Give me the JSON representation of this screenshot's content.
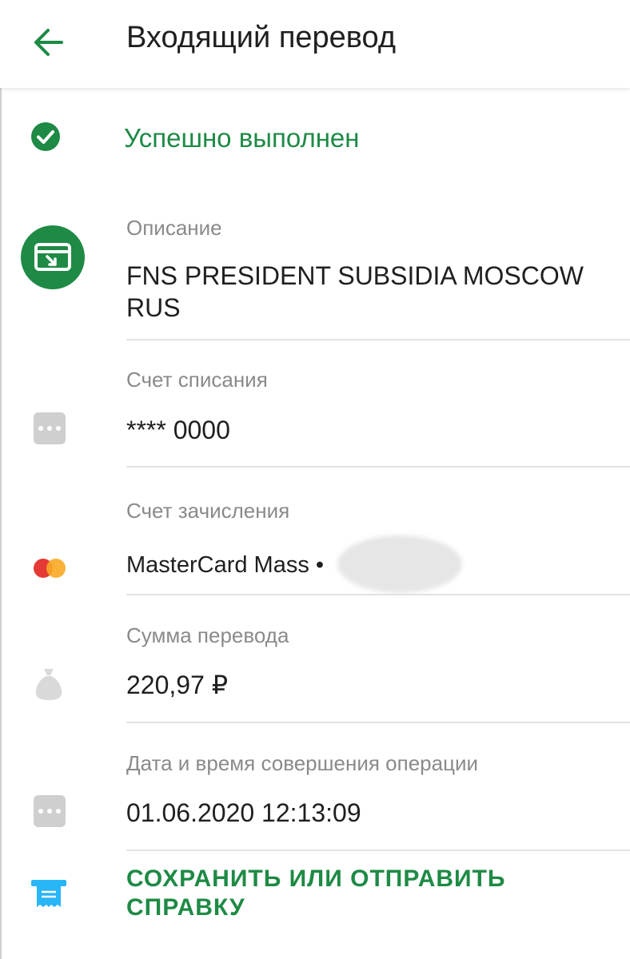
{
  "header": {
    "title": "Входящий перевод",
    "back_icon": "arrow-left-icon"
  },
  "status": {
    "text": "Успешно выполнен",
    "icon": "check-circle-icon"
  },
  "description": {
    "label": "Описание",
    "value": "FNS PRESIDENT SUBSIDIA MOSCOW RUS",
    "icon": "card-incoming-icon"
  },
  "debit_account": {
    "label": "Счет списания",
    "value": "**** 0000",
    "icon": "more-dots-icon"
  },
  "credit_account": {
    "label": "Счет зачисления",
    "value": "MasterCard Mass •",
    "icon": "mastercard-icon"
  },
  "amount": {
    "label": "Сумма перевода",
    "value": "220,97 ₽",
    "icon": "money-bag-icon"
  },
  "datetime": {
    "label": "Дата и время совершения операции",
    "value": "01.06.2020 12:13:09",
    "icon": "more-dots-icon"
  },
  "action": {
    "label": "СОХРАНИТЬ ИЛИ ОТПРАВИТЬ СПРАВКУ",
    "icon": "receipt-icon"
  },
  "colors": {
    "accent": "#1e8a45",
    "label_gray": "#8a8a8a",
    "icon_gray": "#cfcfcf",
    "receipt_blue": "#29b6f6"
  }
}
